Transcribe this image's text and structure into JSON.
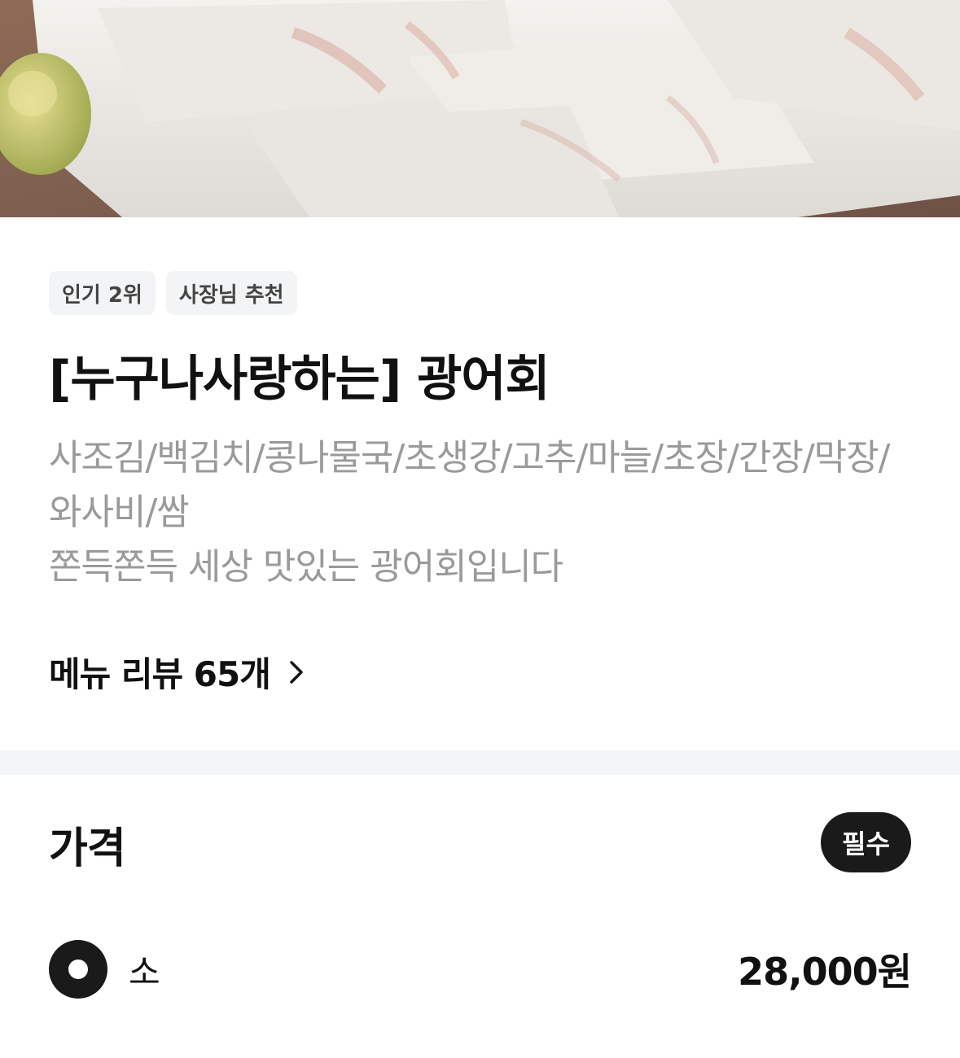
{
  "hero": {
    "image": "flounder-sashimi-photo"
  },
  "badges": [
    "인기 2위",
    "사장님 추천"
  ],
  "menu": {
    "title": "[누구나사랑하는] 광어회",
    "description_line1": "사조김/백김치/콩나물국/초생강/고추/마늘/초장/간장/막장/와사비/쌈",
    "description_line2": "쫀득쫀득 세상 맛있는 광어회입니다",
    "review_link": "메뉴 리뷰 65개",
    "review_icon": "chevron-right-icon"
  },
  "price": {
    "title": "가격",
    "required_label": "필수",
    "options": [
      {
        "label": "소",
        "price": "28,000원",
        "selected": true
      }
    ]
  },
  "colors": {
    "text_primary": "#111111",
    "text_secondary": "#9a9a9a",
    "badge_bg": "#f3f4f6",
    "divider_bg": "#f4f5f6",
    "required_bg": "#1a1a1a"
  }
}
